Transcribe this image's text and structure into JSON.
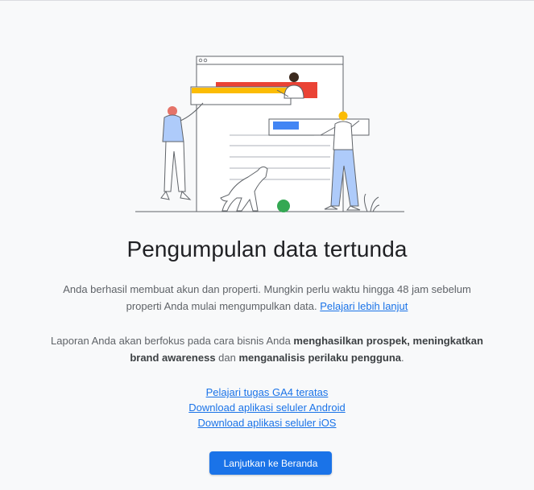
{
  "page": {
    "title": "Pengumpulan data tertunda",
    "paragraph1": {
      "text": "Anda berhasil membuat akun dan properti. Mungkin perlu waktu hingga 48 jam sebelum properti Anda mulai mengumpulkan data.",
      "link": "Pelajari lebih lanjut"
    },
    "paragraph2": {
      "t1": "Laporan Anda akan berfokus pada cara bisnis Anda ",
      "b1": "menghasilkan prospek, meningkatkan brand awareness",
      "t2": " dan ",
      "b2": "menganalisis perilaku pengguna",
      "t3": "."
    },
    "links": [
      "Pelajari tugas GA4 teratas",
      "Download aplikasi seluler Android",
      "Download aplikasi seluler iOS"
    ],
    "cta_button": "Lanjutkan ke Beranda"
  },
  "colors": {
    "accent": "#1a73e8",
    "illustration_red": "#ea4335",
    "illustration_yellow": "#fbbc04",
    "illustration_green": "#34a853",
    "illustration_blue": "#4285f4"
  },
  "icons": [
    "data-collection-illustration"
  ]
}
